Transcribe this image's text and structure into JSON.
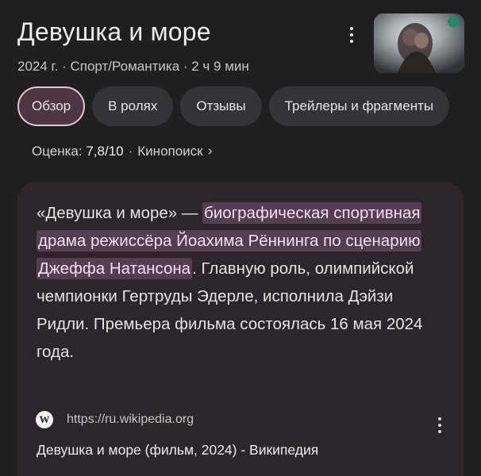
{
  "header": {
    "title": "Девушка и море",
    "meta": "2024 г. · Спорт/Романтика · 2 ч 9 мин"
  },
  "tabs": [
    {
      "label": "Обзор",
      "active": true
    },
    {
      "label": "В ролях",
      "active": false
    },
    {
      "label": "Отзывы",
      "active": false
    },
    {
      "label": "Трейлеры и фрагменты",
      "active": false
    }
  ],
  "rating": {
    "label": "Оценка:",
    "value": "7,8/10",
    "separator": "·",
    "source": "Кинопоиск",
    "chevron": "›"
  },
  "description": {
    "part1": "«Девушка и море» — ",
    "highlight": "биографическая спортивная драма режиссёра Йоахима Рённинга по сценарию Джеффа Натансона",
    "part2": ". Главную роль, олимпийской чемпионки Гертруды Эдерле, исполнила Дэйзи Ридли. Премьера фильма состоялась 16 мая 2024 года."
  },
  "source": {
    "icon_letter": "W",
    "url": "https://ru.wikipedia.org",
    "title": "Девушка и море (фильм, 2024) - Википедия"
  },
  "colors": {
    "background": "#1f1f1f",
    "active_tab": "#4e3545",
    "highlight": "#573d51",
    "accent": "#e4a6c8"
  },
  "icons": [
    "more-vert-icon",
    "wikipedia-icon",
    "chevron-right-icon"
  ]
}
